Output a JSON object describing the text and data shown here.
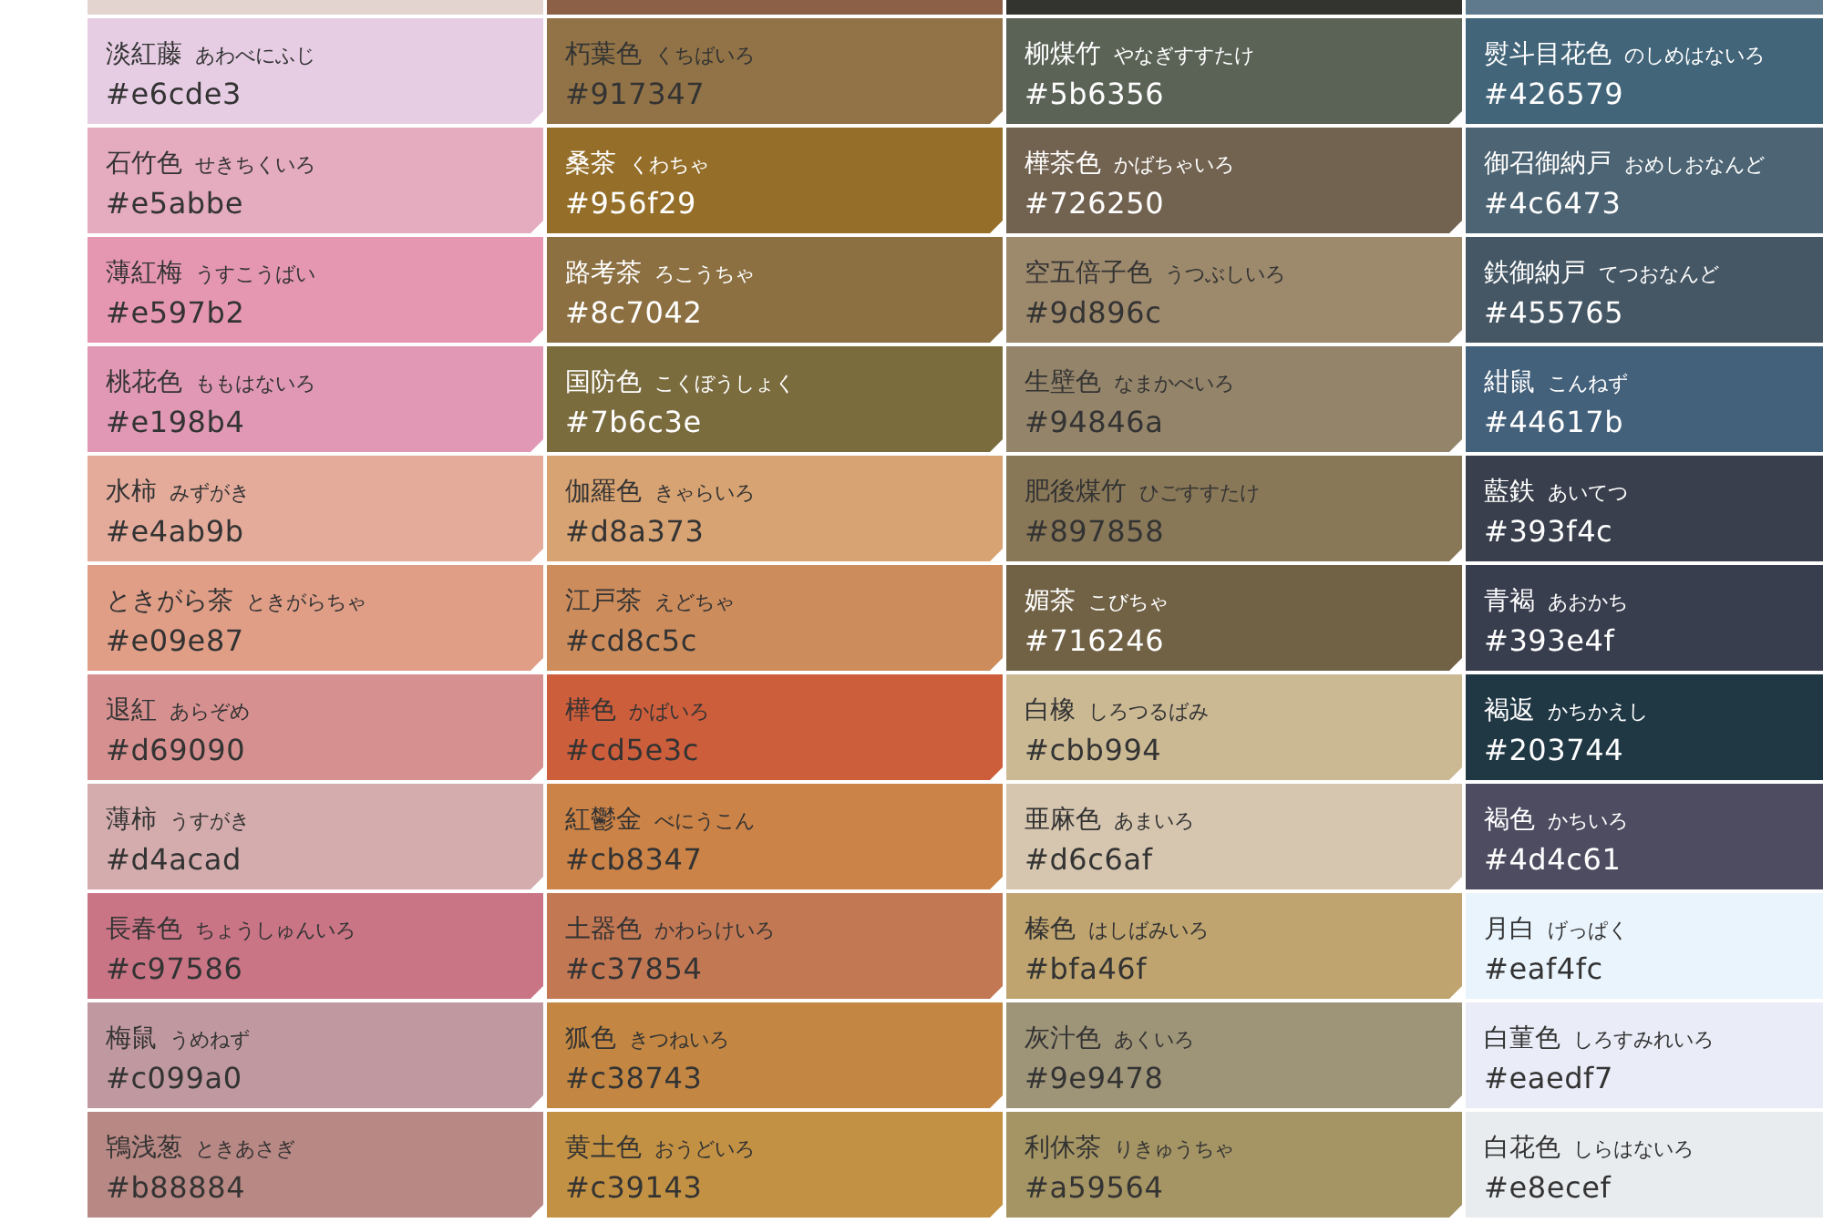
{
  "columns": [
    {
      "swatches": [
        {
          "color": "#e3d4d0"
        },
        {
          "name": "淡紅藤",
          "reading": "あわべにふじ",
          "hex": "#e6cde3",
          "color": "#e6cde3",
          "light_text": false
        },
        {
          "name": "石竹色",
          "reading": "せきちくいろ",
          "hex": "#e5abbe",
          "color": "#e5abbe",
          "light_text": false
        },
        {
          "name": "薄紅梅",
          "reading": "うすこうばい",
          "hex": "#e597b2",
          "color": "#e597b2",
          "light_text": false
        },
        {
          "name": "桃花色",
          "reading": "ももはないろ",
          "hex": "#e198b4",
          "color": "#e198b4",
          "light_text": false
        },
        {
          "name": "水柿",
          "reading": "みずがき",
          "hex": "#e4ab9b",
          "color": "#e4ab9b",
          "light_text": false
        },
        {
          "name": "ときがら茶",
          "reading": "ときがらちゃ",
          "hex": "#e09e87",
          "color": "#e09e87",
          "light_text": false
        },
        {
          "name": "退紅",
          "reading": "あらぞめ",
          "hex": "#d69090",
          "color": "#d69090",
          "light_text": false
        },
        {
          "name": "薄柿",
          "reading": "うすがき",
          "hex": "#d4acad",
          "color": "#d4acad",
          "light_text": false
        },
        {
          "name": "長春色",
          "reading": "ちょうしゅんいろ",
          "hex": "#c97586",
          "color": "#c97586",
          "light_text": false
        },
        {
          "name": "梅鼠",
          "reading": "うめねず",
          "hex": "#c099a0",
          "color": "#c099a0",
          "light_text": false
        },
        {
          "name": "鴇浅葱",
          "reading": "ときあさぎ",
          "hex": "#b88884",
          "color": "#b88884",
          "light_text": false
        }
      ]
    },
    {
      "swatches": [
        {
          "color": "#8b6046"
        },
        {
          "name": "朽葉色",
          "reading": "くちばいろ",
          "hex": "#917347",
          "color": "#917347",
          "light_text": false
        },
        {
          "name": "桑茶",
          "reading": "くわちゃ",
          "hex": "#956f29",
          "color": "#956f29",
          "light_text": true
        },
        {
          "name": "路考茶",
          "reading": "ろこうちゃ",
          "hex": "#8c7042",
          "color": "#8c7042",
          "light_text": true
        },
        {
          "name": "国防色",
          "reading": "こくぼうしょく",
          "hex": "#7b6c3e",
          "color": "#7b6c3e",
          "light_text": true
        },
        {
          "name": "伽羅色",
          "reading": "きゃらいろ",
          "hex": "#d8a373",
          "color": "#d8a373",
          "light_text": false
        },
        {
          "name": "江戸茶",
          "reading": "えどちゃ",
          "hex": "#cd8c5c",
          "color": "#cd8c5c",
          "light_text": false
        },
        {
          "name": "樺色",
          "reading": "かばいろ",
          "hex": "#cd5e3c",
          "color": "#cd5e3c",
          "light_text": false
        },
        {
          "name": "紅鬱金",
          "reading": "べにうこん",
          "hex": "#cb8347",
          "color": "#cb8347",
          "light_text": false
        },
        {
          "name": "土器色",
          "reading": "かわらけいろ",
          "hex": "#c37854",
          "color": "#c37854",
          "light_text": false
        },
        {
          "name": "狐色",
          "reading": "きつねいろ",
          "hex": "#c38743",
          "color": "#c38743",
          "light_text": false
        },
        {
          "name": "黄土色",
          "reading": "おうどいろ",
          "hex": "#c39143",
          "color": "#c39143",
          "light_text": false
        }
      ]
    },
    {
      "swatches": [
        {
          "color": "#33342f"
        },
        {
          "name": "柳煤竹",
          "reading": "やなぎすすたけ",
          "hex": "#5b6356",
          "color": "#5b6356",
          "light_text": true
        },
        {
          "name": "樺茶色",
          "reading": "かばちゃいろ",
          "hex": "#726250",
          "color": "#726250",
          "light_text": true
        },
        {
          "name": "空五倍子色",
          "reading": "うつぶしいろ",
          "hex": "#9d896c",
          "color": "#9d896c",
          "light_text": false
        },
        {
          "name": "生壁色",
          "reading": "なまかべいろ",
          "hex": "#94846a",
          "color": "#94846a",
          "light_text": false
        },
        {
          "name": "肥後煤竹",
          "reading": "ひごすすたけ",
          "hex": "#897858",
          "color": "#897858",
          "light_text": false
        },
        {
          "name": "媚茶",
          "reading": "こびちゃ",
          "hex": "#716246",
          "color": "#716246",
          "light_text": true
        },
        {
          "name": "白橡",
          "reading": "しろつるばみ",
          "hex": "#cbb994",
          "color": "#cbb994",
          "light_text": false
        },
        {
          "name": "亜麻色",
          "reading": "あまいろ",
          "hex": "#d6c6af",
          "color": "#d6c6af",
          "light_text": false
        },
        {
          "name": "榛色",
          "reading": "はしばみいろ",
          "hex": "#bfa46f",
          "color": "#bfa46f",
          "light_text": false
        },
        {
          "name": "灰汁色",
          "reading": "あくいろ",
          "hex": "#9e9478",
          "color": "#9e9478",
          "light_text": false
        },
        {
          "name": "利休茶",
          "reading": "りきゅうちゃ",
          "hex": "#a59564",
          "color": "#a59564",
          "light_text": false
        }
      ]
    },
    {
      "swatches": [
        {
          "color": "#5f7a8c"
        },
        {
          "name": "熨斗目花色",
          "reading": "のしめはないろ",
          "hex": "#426579",
          "color": "#426579",
          "light_text": true
        },
        {
          "name": "御召御納戸",
          "reading": "おめしおなんど",
          "hex": "#4c6473",
          "color": "#4c6473",
          "light_text": true
        },
        {
          "name": "鉄御納戸",
          "reading": "てつおなんど",
          "hex": "#455765",
          "color": "#455765",
          "light_text": true
        },
        {
          "name": "紺鼠",
          "reading": "こんねず",
          "hex": "#44617b",
          "color": "#44617b",
          "light_text": true
        },
        {
          "name": "藍鉄",
          "reading": "あいてつ",
          "hex": "#393f4c",
          "color": "#393f4c",
          "light_text": true
        },
        {
          "name": "青褐",
          "reading": "あおかち",
          "hex": "#393e4f",
          "color": "#393e4f",
          "light_text": true
        },
        {
          "name": "褐返",
          "reading": "かちかえし",
          "hex": "#203744",
          "color": "#203744",
          "light_text": true
        },
        {
          "name": "褐色",
          "reading": "かちいろ",
          "hex": "#4d4c61",
          "color": "#4d4c61",
          "light_text": true
        },
        {
          "name": "月白",
          "reading": "げっぱく",
          "hex": "#eaf4fc",
          "color": "#eaf4fc",
          "light_text": false
        },
        {
          "name": "白菫色",
          "reading": "しろすみれいろ",
          "hex": "#eaedf7",
          "color": "#eaedf7",
          "light_text": false
        },
        {
          "name": "白花色",
          "reading": "しらはないろ",
          "hex": "#e8ecef",
          "color": "#e8ecef",
          "light_text": false
        }
      ]
    }
  ]
}
